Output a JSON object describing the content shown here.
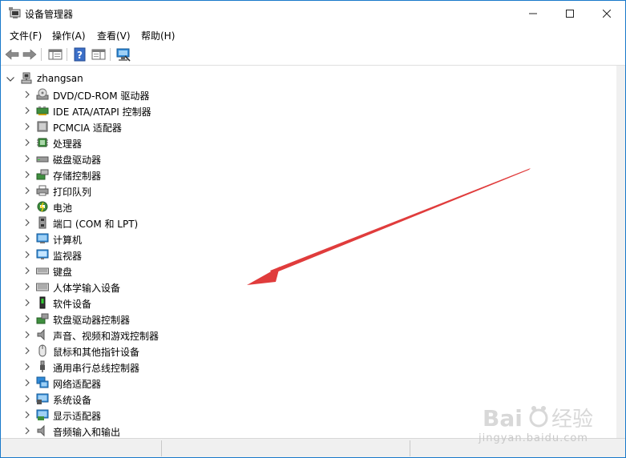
{
  "window": {
    "title": "设备管理器",
    "minimize_icon": "minimize-icon",
    "maximize_icon": "maximize-icon",
    "close_icon": "close-icon"
  },
  "menu": [
    "文件(F)",
    "操作(A)",
    "查看(V)",
    "帮助(H)"
  ],
  "toolbar": [
    "back-icon",
    "forward-icon",
    "show-hide-console-tree-icon",
    "help-icon",
    "properties-pane-icon",
    "scan-hardware-icon"
  ],
  "tree": {
    "root": "zhangsan",
    "nodes": [
      {
        "label": "DVD/CD-ROM 驱动器",
        "icon": "dvd-drive-icon"
      },
      {
        "label": "IDE ATA/ATAPI 控制器",
        "icon": "ide-controller-icon"
      },
      {
        "label": "PCMCIA 适配器",
        "icon": "pcmcia-adapter-icon"
      },
      {
        "label": "处理器",
        "icon": "processor-icon"
      },
      {
        "label": "磁盘驱动器",
        "icon": "disk-drive-icon"
      },
      {
        "label": "存储控制器",
        "icon": "storage-controller-icon"
      },
      {
        "label": "打印队列",
        "icon": "printer-icon"
      },
      {
        "label": "电池",
        "icon": "battery-icon"
      },
      {
        "label": "端口 (COM 和 LPT)",
        "icon": "port-icon"
      },
      {
        "label": "计算机",
        "icon": "computer-icon"
      },
      {
        "label": "监视器",
        "icon": "monitor-icon"
      },
      {
        "label": "键盘",
        "icon": "keyboard-icon"
      },
      {
        "label": "人体学输入设备",
        "icon": "hid-icon"
      },
      {
        "label": "软件设备",
        "icon": "software-device-icon"
      },
      {
        "label": "软盘驱动器控制器",
        "icon": "floppy-controller-icon"
      },
      {
        "label": "声音、视频和游戏控制器",
        "icon": "sound-icon"
      },
      {
        "label": "鼠标和其他指针设备",
        "icon": "mouse-icon"
      },
      {
        "label": "通用串行总线控制器",
        "icon": "usb-icon"
      },
      {
        "label": "网络适配器",
        "icon": "network-adapter-icon"
      },
      {
        "label": "系统设备",
        "icon": "system-device-icon"
      },
      {
        "label": "显示适配器",
        "icon": "display-adapter-icon"
      },
      {
        "label": "音频输入和输出",
        "icon": "audio-io-icon"
      }
    ]
  },
  "annotation": {
    "arrow_color": "#e03c3c",
    "arrow_icon": "red-arrow-annotation"
  },
  "watermark": {
    "text": "jingyan.baidu.com",
    "logo": "baidu-jingyan-logo"
  },
  "colors": {
    "window_border": "#1979ca",
    "toolbar_sep": "#c8c8c8",
    "status_bg": "#f0f0f0"
  }
}
